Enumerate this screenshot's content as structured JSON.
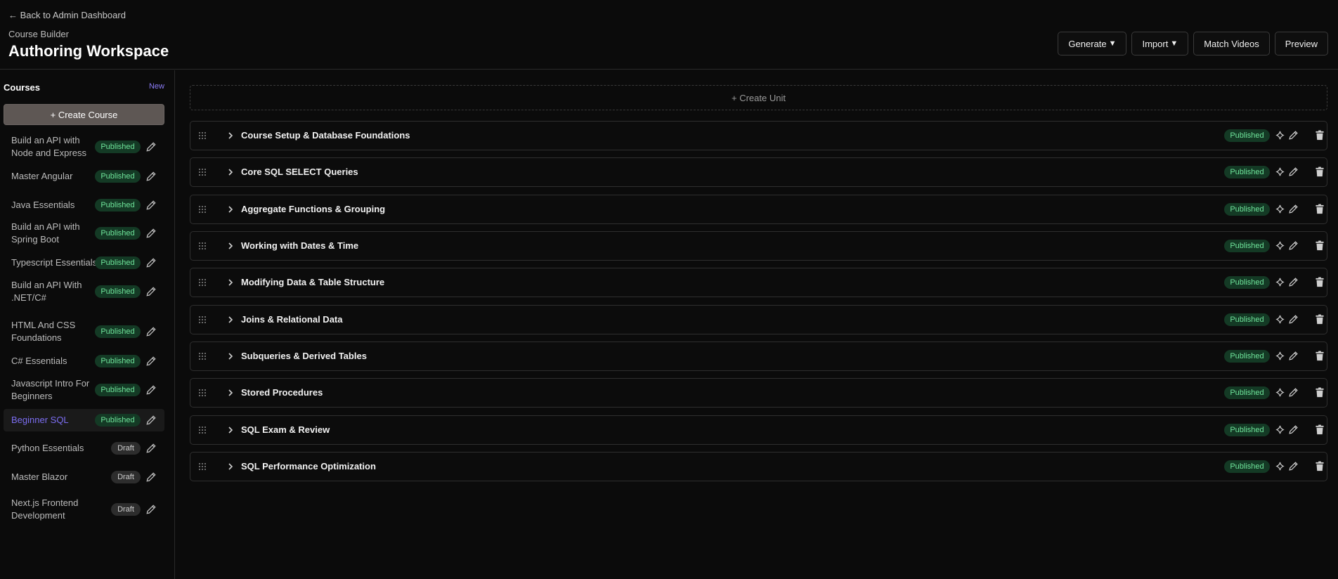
{
  "header": {
    "back_link": "← Back to Admin Dashboard",
    "subtitle": "Course Builder",
    "title": "Authoring Workspace",
    "actions": [
      {
        "label": "Generate",
        "caret": "▼"
      },
      {
        "label": "Import",
        "caret": "▼"
      },
      {
        "label": "Match Videos",
        "caret": ""
      },
      {
        "label": "Preview",
        "caret": ""
      }
    ]
  },
  "sidebar": {
    "title": "Courses",
    "new_label": "New",
    "create_label": "+ Create Course",
    "courses": [
      {
        "name": "Build an API with Node and Express",
        "status": "Published",
        "active": false
      },
      {
        "name": "Master Angular",
        "status": "Published",
        "active": false
      },
      {
        "name": "Java Essentials",
        "status": "Published",
        "active": false
      },
      {
        "name": "Build an API with Spring Boot",
        "status": "Published",
        "active": false
      },
      {
        "name": "Typescript Essentials",
        "status": "Published",
        "active": false
      },
      {
        "name": "Build an API With .NET/C#",
        "status": "Published",
        "active": false
      },
      {
        "name": "HTML And CSS Foundations",
        "status": "Published",
        "active": false
      },
      {
        "name": "C# Essentials",
        "status": "Published",
        "active": false
      },
      {
        "name": "Javascript Intro For Beginners",
        "status": "Published",
        "active": false
      },
      {
        "name": "Beginner SQL",
        "status": "Published",
        "active": true
      },
      {
        "name": "Python Essentials",
        "status": "Draft",
        "active": false
      },
      {
        "name": "Master Blazor",
        "status": "Draft",
        "active": false
      },
      {
        "name": "Next.js Frontend Development",
        "status": "Draft",
        "active": false
      }
    ]
  },
  "main": {
    "create_unit_label": "+ Create Unit",
    "units": [
      {
        "title": "Course Setup & Database Foundations",
        "status": "Published"
      },
      {
        "title": "Core SQL SELECT Queries",
        "status": "Published"
      },
      {
        "title": "Aggregate Functions & Grouping",
        "status": "Published"
      },
      {
        "title": "Working with Dates & Time",
        "status": "Published"
      },
      {
        "title": "Modifying Data & Table Structure",
        "status": "Published"
      },
      {
        "title": "Joins & Relational Data",
        "status": "Published"
      },
      {
        "title": "Subqueries & Derived Tables",
        "status": "Published"
      },
      {
        "title": "Stored Procedures",
        "status": "Published"
      },
      {
        "title": "SQL Exam & Review",
        "status": "Published"
      },
      {
        "title": "SQL Performance Optimization",
        "status": "Published"
      }
    ]
  },
  "colors": {
    "background": "#0b0b0b",
    "accent": "#7c6ef2",
    "published_bg": "#143a25",
    "published_text": "#6fe59b",
    "create_course_bg": "#5e5754"
  }
}
